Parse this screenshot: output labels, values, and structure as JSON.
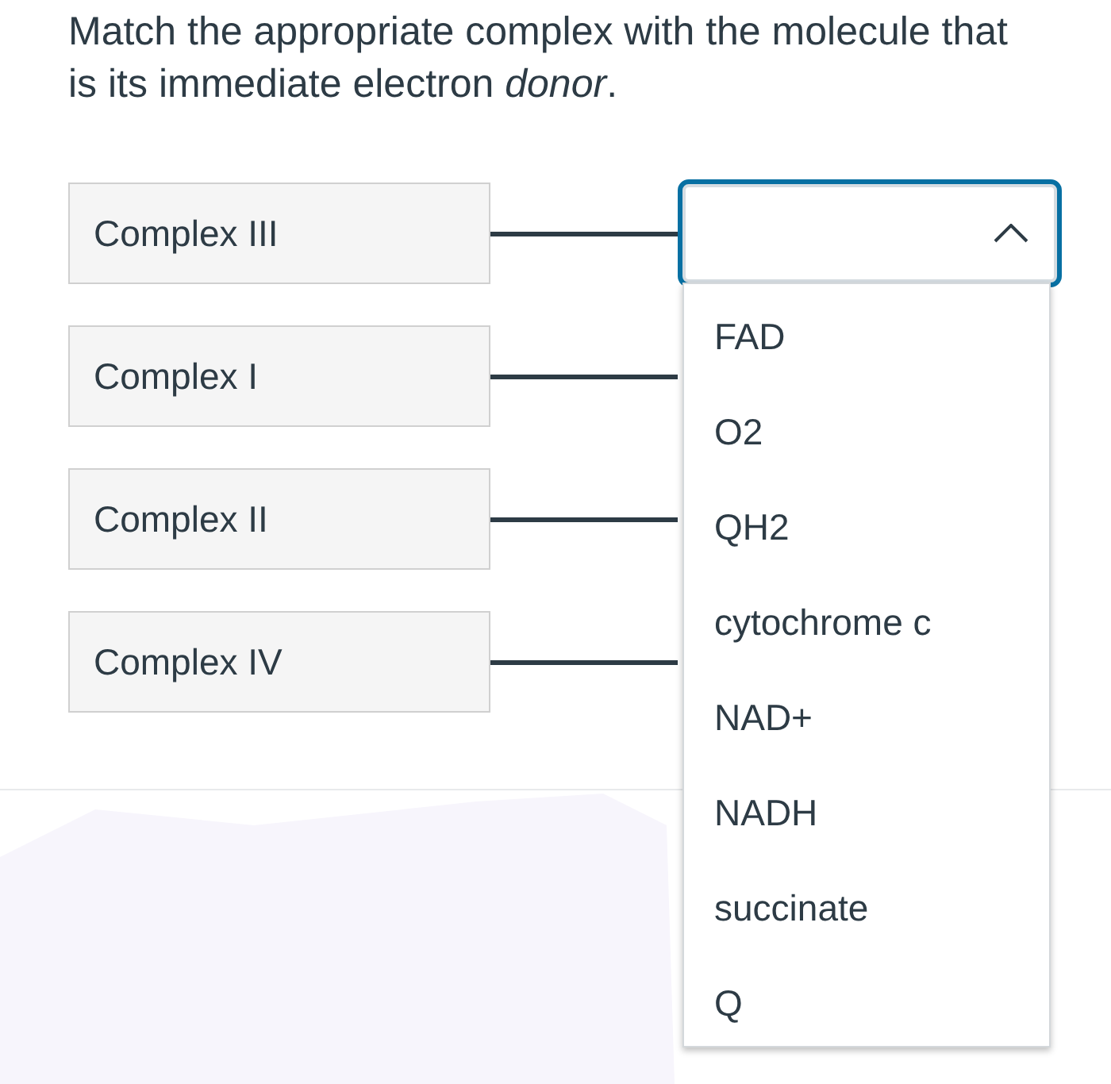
{
  "question": "Match the appropriate complex with the molecule that is its immediate electron *donor*.",
  "pairs": [
    {
      "label": "Complex III",
      "open": true
    },
    {
      "label": "Complex I",
      "open": false
    },
    {
      "label": "Complex II",
      "open": false
    },
    {
      "label": "Complex IV",
      "open": false
    }
  ],
  "menu": {
    "options": [
      {
        "label": "FAD"
      },
      {
        "label": "O2"
      },
      {
        "label": "QH2"
      },
      {
        "label": "cytochrome c"
      },
      {
        "label": "NAD+"
      },
      {
        "label": "NADH"
      },
      {
        "label": "succinate"
      },
      {
        "label": "Q"
      }
    ]
  }
}
